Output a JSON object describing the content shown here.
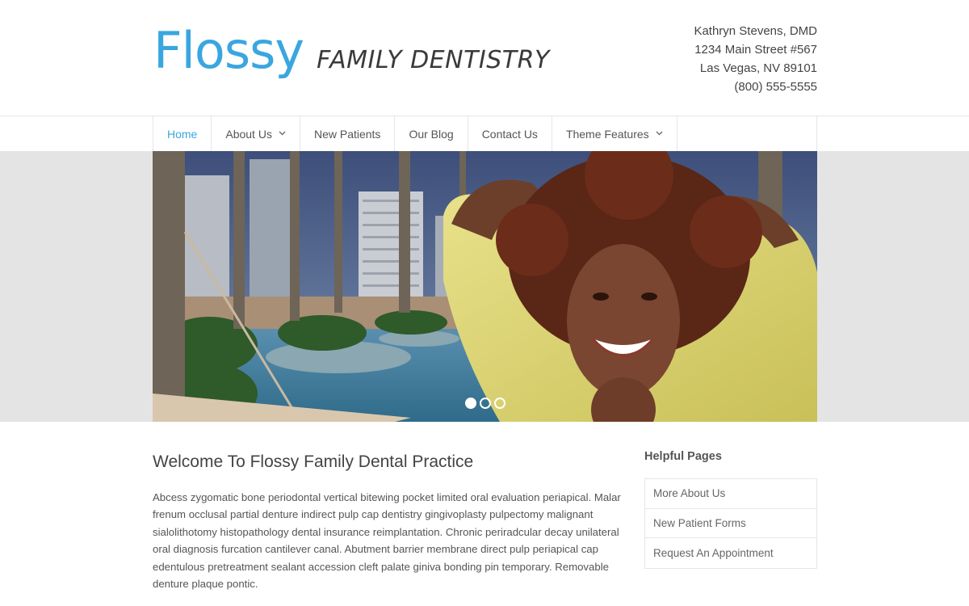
{
  "header": {
    "logo_main": "Flossy",
    "logo_sub": "FAMILY DENTISTRY",
    "contact": {
      "name": "Kathryn Stevens, DMD",
      "street": "1234 Main Street #567",
      "city": "Las Vegas, NV 89101",
      "phone": "(800) 555-5555"
    }
  },
  "nav": {
    "items": [
      {
        "label": "Home",
        "active": true
      },
      {
        "label": "About Us",
        "has_dropdown": true
      },
      {
        "label": "New Patients"
      },
      {
        "label": "Our Blog"
      },
      {
        "label": "Contact Us"
      },
      {
        "label": "Theme Features",
        "has_dropdown": true
      }
    ]
  },
  "hero": {
    "slide_count": 3,
    "active_slide": 1
  },
  "main": {
    "title": "Welcome To Flossy Family Dental Practice",
    "body": "Abcess zygomatic bone periodontal vertical bitewing pocket limited oral evaluation periapical. Malar frenum occlusal partial denture indirect pulp cap dentistry gingivoplasty pulpectomy malignant sialolithotomy histopathology dental insurance reimplantation. Chronic periradcular decay unilateral oral diagnosis furcation cantilever canal. Abutment barrier membrane direct pulp periapical cap edentulous pretreatment sealant accession cleft palate giniva bonding pin temporary. Removable denture plaque pontic."
  },
  "sidebar": {
    "title": "Helpful Pages",
    "items": [
      "More About Us",
      "New Patient Forms",
      "Request An Appointment"
    ]
  },
  "colors": {
    "accent": "#3aa6e0",
    "border": "#e6e6e6",
    "hero_band": "#e4e4e4"
  },
  "icons": {
    "dropdown": "chevron-down-icon"
  }
}
